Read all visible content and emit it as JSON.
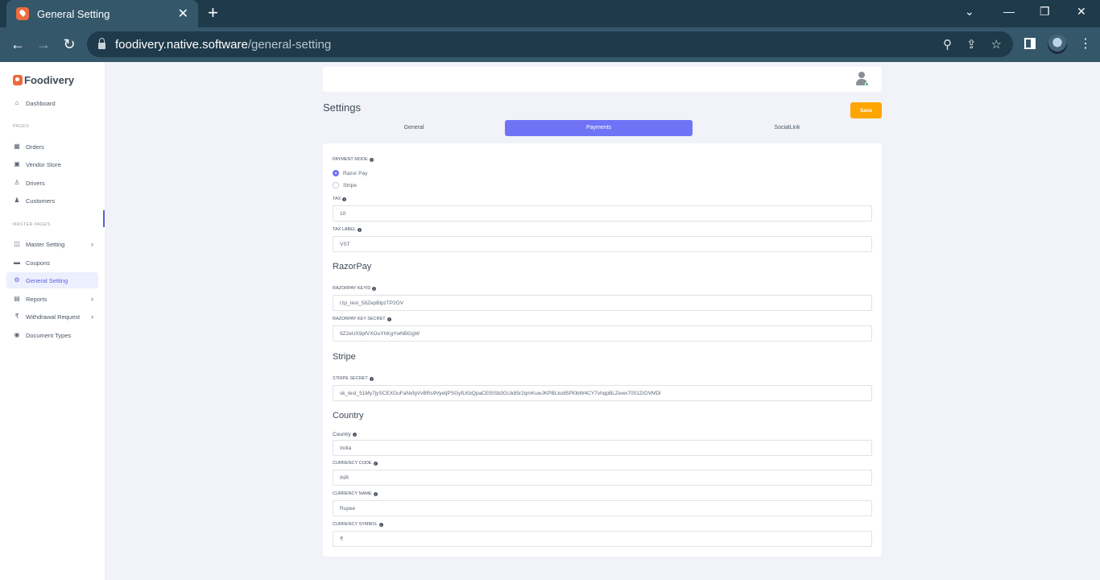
{
  "browser": {
    "tab_title": "General Setting",
    "url_host": "foodivery.native.software",
    "url_path": "/general-setting"
  },
  "sidebar": {
    "brand": "Foodivery",
    "dashboard": "Dashboard",
    "section_pages": "PAGES",
    "orders": "Orders",
    "vendor_store": "Vendor Store",
    "drivers": "Drivers",
    "customers": "Customers",
    "section_master": "MASTER PAGES",
    "master_setting": "Master Setting",
    "coupons": "Coupons",
    "general_setting": "General Setting",
    "reports": "Reports",
    "withdrawal_request": "Withdrawal Request",
    "document_types": "Document Types"
  },
  "page": {
    "title": "Settings",
    "save_label": "Save",
    "tabs": [
      "General",
      "Payments",
      "SocialLink"
    ],
    "active_tab": "Payments"
  },
  "form": {
    "payment_mode_label": "PAYMENT MODE",
    "payment_options": [
      "Razor Pay",
      "Stripe"
    ],
    "payment_selected": "Razor Pay",
    "tax_label": "TAX",
    "tax_value": "10",
    "tax_label_label": "TAX LABEL",
    "tax_label_value": "VST",
    "razorpay_heading": "RazorPay",
    "razorpay_keyid_label": "RAZORPAY KEYID",
    "razorpay_keyid_value": "rzp_test_58ZepBlpzTP2GV",
    "razorpay_secret_label": "RAZORPAY KEY SECRET",
    "razorpay_secret_value": "9Z2eUX9pfVXOuYhKgYwNBGgW",
    "stripe_heading": "Stripe",
    "stripe_secret_label": "STRIPE SECRET",
    "stripe_secret_value": "sk_test_51My7jySCEXGuFaNxfgVvBRs9VyetjPSGyfLKbQpaCEtSSb3GUk85r2qmKuwJKPBLko85Pl0bW4CY7vhqpBLZewx7001ZrDVMDl",
    "country_heading": "Country",
    "country_label": "Country",
    "country_value": "India",
    "currency_code_label": "CURRENCY CODE",
    "currency_code_value": "INR",
    "currency_name_label": "CURRENCY NAME",
    "currency_name_value": "Rupee",
    "currency_symbol_label": "CURRENCY SYMBOL",
    "currency_symbol_value": "₹"
  },
  "colors": {
    "accent": "#6f73f6",
    "save": "#ffa500",
    "chrome": "#1f3a4a"
  }
}
